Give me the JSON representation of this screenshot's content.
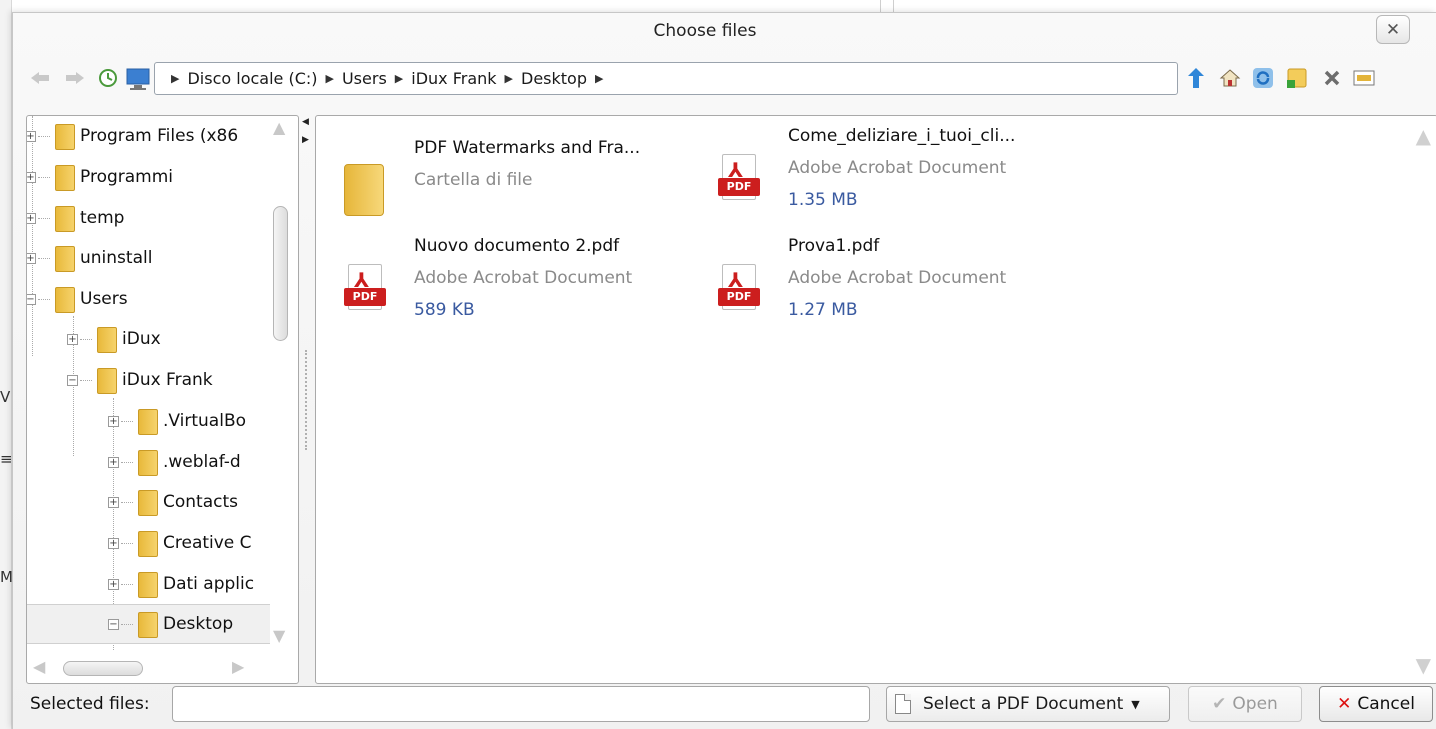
{
  "dialog": {
    "title": "Choose files",
    "close_icon": "close-icon"
  },
  "toolbar": {
    "icons": [
      "back-arrow-icon",
      "forward-arrow-icon",
      "history-icon",
      "computer-icon",
      "parent-folder-icon",
      "home-icon",
      "refresh-icon",
      "new-folder-icon",
      "delete-icon",
      "view-mode-icon"
    ]
  },
  "path": {
    "crumbs": [
      "Disco locale (C:)",
      "Users",
      "iDux Frank",
      "Desktop"
    ]
  },
  "tree": {
    "items": [
      {
        "label": "Program Files (x86"
      },
      {
        "label": "Programmi"
      },
      {
        "label": "temp"
      },
      {
        "label": "uninstall"
      },
      {
        "label": "Users"
      },
      {
        "label": "iDux"
      },
      {
        "label": "iDux Frank"
      },
      {
        "label": ".VirtualBo"
      },
      {
        "label": ".weblaf-d"
      },
      {
        "label": "Contacts"
      },
      {
        "label": "Creative C"
      },
      {
        "label": "Dati applic"
      },
      {
        "label": "Desktop"
      }
    ]
  },
  "files": {
    "items": [
      {
        "name": "PDF Watermarks and Fra...",
        "type": "Cartella di file",
        "size": ""
      },
      {
        "name": "Come_deliziare_i_tuoi_cli...",
        "type": "Adobe Acrobat Document",
        "size": "1.35 MB"
      },
      {
        "name": "Nuovo documento 2.pdf",
        "type": "Adobe Acrobat Document",
        "size": "589 KB"
      },
      {
        "name": "Prova1.pdf",
        "type": "Adobe Acrobat Document",
        "size": "1.27 MB"
      }
    ],
    "pdf_badge": "PDF"
  },
  "bottom": {
    "selected_label": "Selected files:",
    "selected_value": "",
    "filter_label": "Select a PDF Document",
    "open_label": "Open",
    "cancel_label": "Cancel"
  },
  "background": {
    "glyph_1": "V",
    "glyph_2": "M"
  }
}
